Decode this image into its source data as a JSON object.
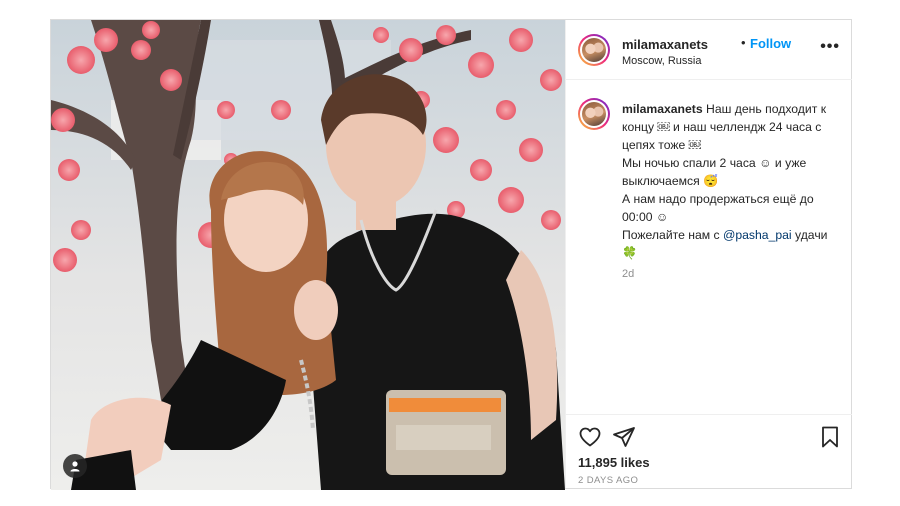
{
  "post": {
    "username": "milamaxanets",
    "separator": "•",
    "follow_label": "Follow",
    "location": "Moscow, Russia",
    "more_label": "•••",
    "caption": {
      "username": "milamaxanets",
      "lines": [
        "Наш день подходит к концу ￼ и наш челлендж 24 часа с цепях тоже ￼",
        "Мы ночью спали 2 часа ☺ и уже выключаемся 😴",
        "А нам надо продержаться ещё до 00:00 ☺",
        "Пожелайте нам с"
      ],
      "mention": "@pasha_pai",
      "after_mention": " удачи",
      "clover": "🍀"
    },
    "time_ago": "2d",
    "likes": "11,895 likes",
    "posted_label": "2 DAYS AGO",
    "icons": {
      "like": "heart-icon",
      "share": "send-icon",
      "save": "bookmark-icon",
      "tags": "user-tag-icon"
    },
    "colors": {
      "link": "#0095f6",
      "mention": "#00376b",
      "muted": "#8e8e8e",
      "border": "#dbdbdb"
    }
  }
}
